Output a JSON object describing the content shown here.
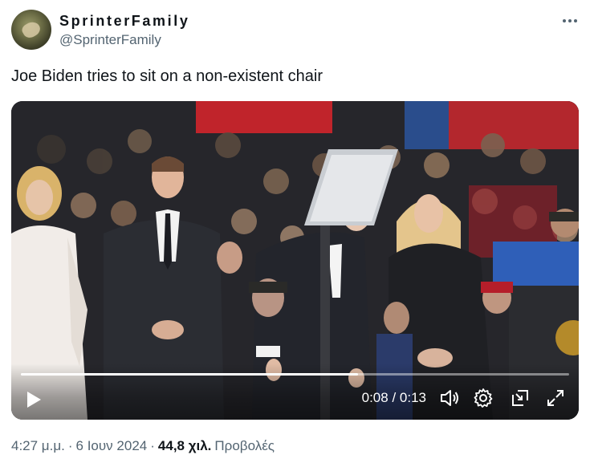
{
  "author": {
    "display_name": "SprinterFamily",
    "handle": "@SprinterFamily"
  },
  "tweet": {
    "text": "Joe Biden tries to sit on a non-existent chair"
  },
  "video": {
    "current_time": "0:08",
    "duration": "0:13",
    "time_separator": "/",
    "progress_fraction": 0.615,
    "icons": [
      "play-icon",
      "volume-icon",
      "settings-gear-icon",
      "picture-in-picture-icon",
      "fullscreen-icon"
    ]
  },
  "meta": {
    "time": "4:27 μ.μ.",
    "dot1": "·",
    "date": "6 Ιουν 2024",
    "dot2": "·",
    "views_count": "44,8 χιλ.",
    "views_label": "Προβολές"
  },
  "more_icon": "more-horizontal-icon",
  "colors": {
    "text_primary": "#0f1419",
    "text_secondary": "#536471",
    "video_bg": "#1c1c1f"
  }
}
